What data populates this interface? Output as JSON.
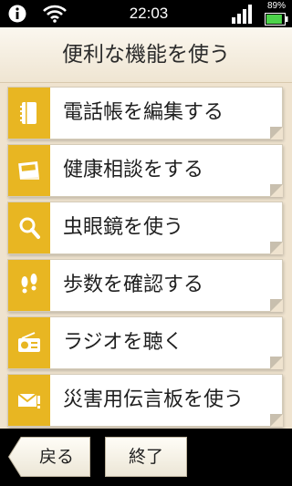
{
  "status_bar": {
    "time": "22:03",
    "battery_percent": "89%",
    "battery_level": 0.89,
    "icons": [
      "info-icon",
      "wifi-icon",
      "signal-icon",
      "battery-icon"
    ]
  },
  "header": {
    "title": "便利な機能を使う"
  },
  "accent_color": "#e8b622",
  "menu": {
    "items": [
      {
        "label": "電話帳を編集する",
        "icon": "phonebook-icon"
      },
      {
        "label": "健康相談をする",
        "icon": "health-book-icon"
      },
      {
        "label": "虫眼鏡を使う",
        "icon": "magnifier-icon"
      },
      {
        "label": "歩数を確認する",
        "icon": "footprints-icon"
      },
      {
        "label": "ラジオを聴く",
        "icon": "radio-icon"
      },
      {
        "label": "災害用伝言板を使う",
        "icon": "disaster-message-icon"
      }
    ]
  },
  "footer": {
    "back_label": "戻る",
    "end_label": "終了"
  }
}
